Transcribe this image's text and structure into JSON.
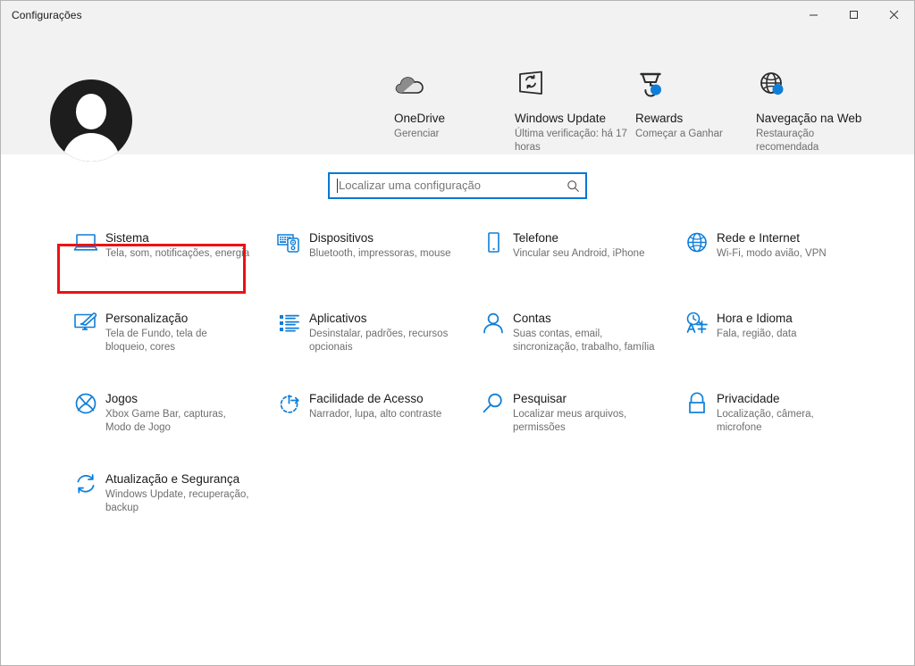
{
  "window": {
    "title": "Configurações",
    "controls": {
      "minimize": "minimize-icon",
      "maximize": "maximize-icon",
      "close": "close-icon"
    }
  },
  "header": {
    "avatar": "user-avatar",
    "tiles": [
      {
        "icon": "onedrive-cloud-icon",
        "title": "OneDrive",
        "sub": "Gerenciar"
      },
      {
        "icon": "windows-update-icon",
        "title": "Windows Update",
        "sub": "Última verificação: há 17 horas"
      },
      {
        "icon": "rewards-medal-icon",
        "title": "Rewards",
        "sub": "Começar a Ganhar"
      },
      {
        "icon": "web-globe-icon",
        "title": "Navegação na Web",
        "sub": "Restauração recomendada"
      }
    ]
  },
  "search": {
    "placeholder": "Localizar uma configuração",
    "value": "",
    "icon": "search-icon",
    "focused": true
  },
  "accent_color": "#0078d4",
  "highlight_color": "#ee1111",
  "tiles": [
    {
      "icon": "system-laptop-icon",
      "title": "Sistema",
      "sub": "Tela, som, notificações, energia",
      "highlighted": true
    },
    {
      "icon": "devices-icon",
      "title": "Dispositivos",
      "sub": "Bluetooth, impressoras, mouse",
      "highlighted": false
    },
    {
      "icon": "phone-icon",
      "title": "Telefone",
      "sub": "Vincular seu Android, iPhone",
      "highlighted": false
    },
    {
      "icon": "network-globe-icon",
      "title": "Rede e Internet",
      "sub": "Wi-Fi, modo avião, VPN",
      "highlighted": false
    },
    {
      "icon": "personalization-icon",
      "title": "Personalização",
      "sub": "Tela de Fundo, tela de bloqueio, cores",
      "highlighted": false
    },
    {
      "icon": "apps-list-icon",
      "title": "Aplicativos",
      "sub": "Desinstalar, padrões, recursos opcionais",
      "highlighted": false
    },
    {
      "icon": "accounts-person-icon",
      "title": "Contas",
      "sub": "Suas contas, email, sincronização, trabalho, família",
      "highlighted": false
    },
    {
      "icon": "time-language-icon",
      "title": "Hora e Idioma",
      "sub": "Fala, região, data",
      "highlighted": false
    },
    {
      "icon": "gaming-xbox-icon",
      "title": "Jogos",
      "sub": "Xbox Game Bar, capturas, Modo de Jogo",
      "highlighted": false
    },
    {
      "icon": "ease-of-access-icon",
      "title": "Facilidade de Acesso",
      "sub": "Narrador, lupa, alto contraste",
      "highlighted": false
    },
    {
      "icon": "search-magnifier-icon",
      "title": "Pesquisar",
      "sub": "Localizar meus arquivos, permissões",
      "highlighted": false
    },
    {
      "icon": "privacy-lock-icon",
      "title": "Privacidade",
      "sub": "Localização, câmera, microfone",
      "highlighted": false
    },
    {
      "icon": "update-security-icon",
      "title": "Atualização e Segurança",
      "sub": "Windows Update, recuperação, backup",
      "highlighted": false
    }
  ]
}
